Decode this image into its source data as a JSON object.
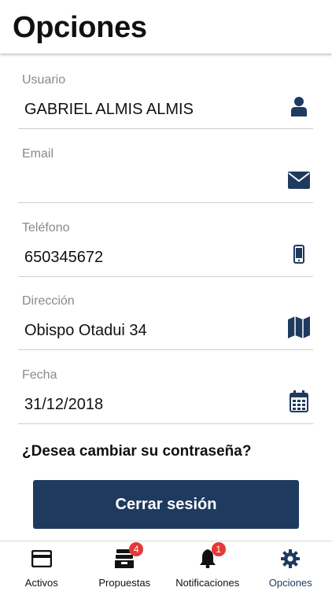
{
  "header": {
    "title": "Opciones"
  },
  "fields": [
    {
      "label": "Usuario",
      "value": "GABRIEL ALMIS ALMIS",
      "icon": "user-icon"
    },
    {
      "label": "Email",
      "value": "",
      "icon": "envelope-icon"
    },
    {
      "label": "Teléfono",
      "value": "650345672",
      "icon": "mobile-phone-icon"
    },
    {
      "label": "Dirección",
      "value": "Obispo Otadui 34",
      "icon": "map-icon"
    },
    {
      "label": "Fecha",
      "value": "31/12/2018",
      "icon": "calendar-icon"
    }
  ],
  "change_password": "¿Desea cambiar su contraseña?",
  "logout_label": "Cerrar sesión",
  "tabs": [
    {
      "label": "Activos",
      "icon": "credit-card-icon"
    },
    {
      "label": "Propuestas",
      "icon": "inbox-icon",
      "badge": "4"
    },
    {
      "label": "Notificaciones",
      "icon": "bell-icon",
      "badge": "1"
    },
    {
      "label": "Opciones",
      "icon": "gear-icon",
      "active": true
    }
  ],
  "colors": {
    "accent": "#1f3a5f",
    "badge": "#e53935",
    "label": "#8a8a8a"
  }
}
